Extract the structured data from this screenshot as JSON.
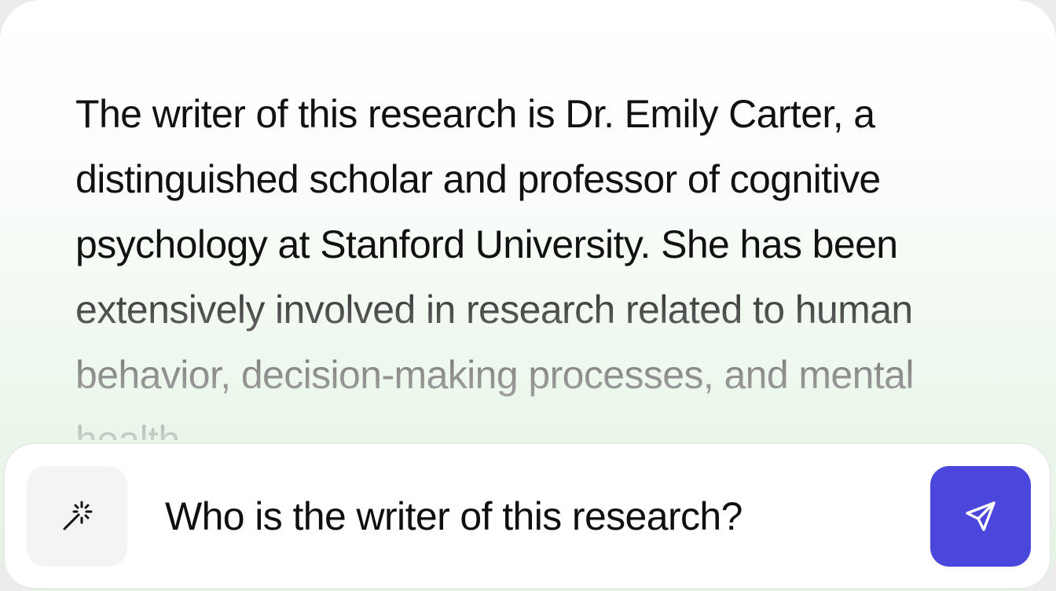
{
  "response": {
    "text": "The writer of this research is Dr. Emily Carter, a distinguished scholar and professor of cognitive psychology at Stanford University. She has been extensively involved in research related to human behavior, decision-making processes, and mental health."
  },
  "input": {
    "query": "Who is the writer of this research?"
  },
  "icons": {
    "left_button": "magic-wand-icon",
    "right_button": "send-icon"
  },
  "colors": {
    "send_button": "#4b46dc",
    "magic_button_bg": "#f3f4f6",
    "text": "#111111"
  }
}
